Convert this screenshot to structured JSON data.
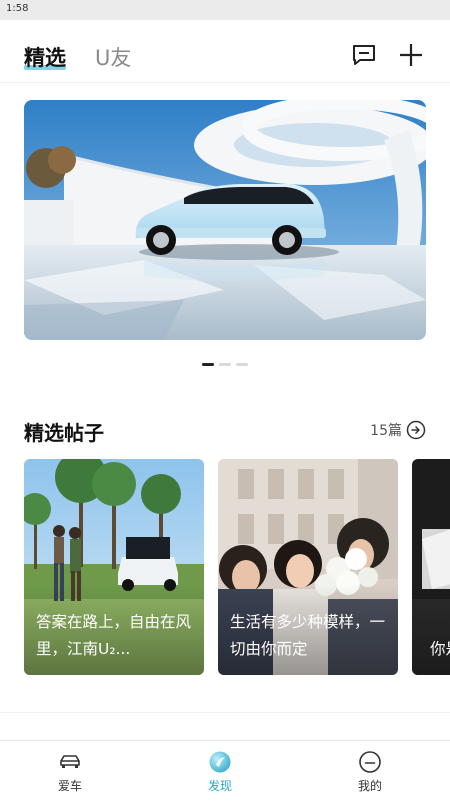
{
  "status_bar": {
    "time": "1:58"
  },
  "header": {
    "tabs": [
      {
        "label": "精选",
        "active": true
      },
      {
        "label": "U友",
        "active": false
      }
    ],
    "message_icon": "message-square-icon",
    "add_icon": "plus-icon"
  },
  "banner": {
    "page_count": 3,
    "active_index": 0
  },
  "featured": {
    "title": "精选帖子",
    "count": "15篇",
    "more_icon": "arrow-right-circle-icon",
    "posts": [
      {
        "title": "答案在路上，自由在风里，江南U₂..."
      },
      {
        "title": "生活有多少种模样，一切由你而定"
      },
      {
        "title": "你是由我"
      }
    ]
  },
  "bottom_nav": {
    "items": [
      {
        "label": "爱车",
        "icon": "car-icon",
        "active": false
      },
      {
        "label": "发现",
        "icon": "discover-icon",
        "active": true
      },
      {
        "label": "我的",
        "icon": "profile-icon",
        "active": false
      }
    ]
  },
  "colors": {
    "accent": "#2aa6c9",
    "tab_underline": "#7fd3e6",
    "dot_active": "#222222",
    "dot_inactive": "#d9d9d9"
  }
}
